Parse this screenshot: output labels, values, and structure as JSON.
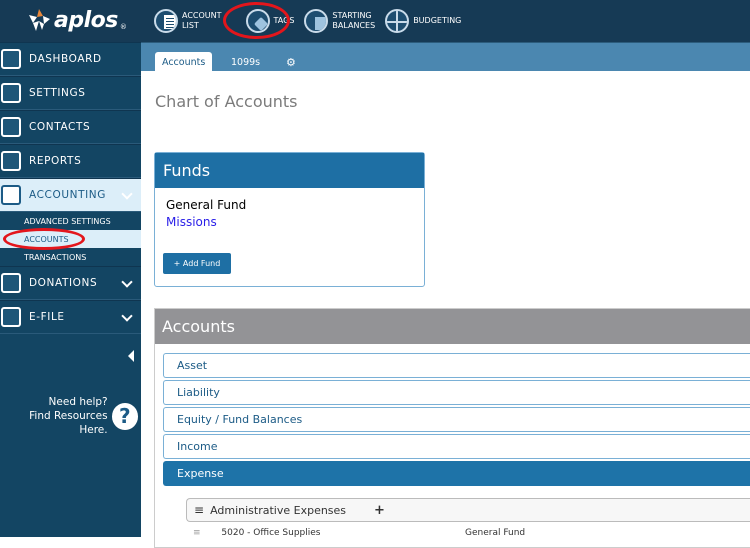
{
  "brand": {
    "name": "aplos",
    "reg": "®"
  },
  "topnav": [
    {
      "icon": "account-list-icon",
      "line1": "Account",
      "line2": "List"
    },
    {
      "icon": "tag-icon",
      "line1": "Tags",
      "line2": ""
    },
    {
      "icon": "starting-balances-icon",
      "line1": "Starting",
      "line2": "Balances"
    },
    {
      "icon": "budgeting-icon",
      "line1": "Budgeting",
      "line2": ""
    }
  ],
  "sidebar": {
    "items": [
      {
        "label": "DASHBOARD",
        "icon": "dashboard-icon"
      },
      {
        "label": "SETTINGS",
        "icon": "settings-icon"
      },
      {
        "label": "CONTACTS",
        "icon": "contacts-icon"
      },
      {
        "label": "REPORTS",
        "icon": "reports-icon"
      },
      {
        "label": "ACCOUNTING",
        "icon": "accounting-icon",
        "active": true
      }
    ],
    "sub_items": [
      {
        "label": "ADVANCED SETTINGS"
      },
      {
        "label": "ACCOUNTS",
        "active": true
      },
      {
        "label": "TRANSACTIONS"
      }
    ],
    "items_after": [
      {
        "label": "DONATIONS",
        "icon": "donations-icon"
      },
      {
        "label": "E-FILE",
        "icon": "efile-icon"
      }
    ],
    "help_line1": "Need help?",
    "help_line2": "Find Resources Here.",
    "help_glyph": "?"
  },
  "tabs": [
    {
      "label": "Accounts",
      "active": true
    },
    {
      "label": "1099s"
    },
    {
      "label": "⚙",
      "icon": "gears-icon"
    }
  ],
  "page_title": "Chart of Accounts",
  "funds": {
    "title": "Funds",
    "items": [
      {
        "label": "General Fund",
        "color": "#000000"
      },
      {
        "label": "Missions",
        "color": "#2a1fe8"
      }
    ],
    "add_button": "+ Add Fund"
  },
  "accounts": {
    "title": "Accounts",
    "categories": [
      "Asset",
      "Liability",
      "Equity / Fund Balances",
      "Income",
      "Expense"
    ],
    "active_category": "Expense",
    "group": {
      "label": "Administrative Expenses",
      "add": "+"
    },
    "rows": [
      {
        "name": "5020 - Office Supplies",
        "fund": "General Fund"
      }
    ]
  },
  "colors": {
    "topbar": "#163a55",
    "sidebar": "#134563",
    "accent": "#1e6fa4",
    "annotation": "#e3161c"
  }
}
